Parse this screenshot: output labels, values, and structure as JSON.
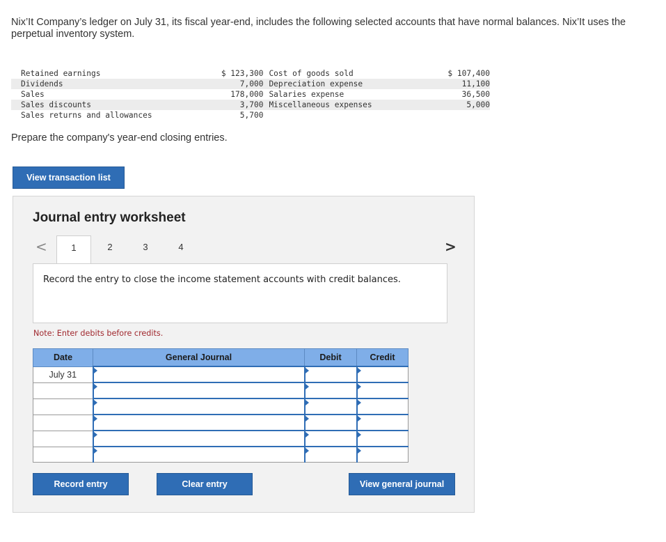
{
  "intro": "Nix’It Company’s ledger on July 31, its fiscal year-end, includes the following selected accounts that have normal balances. Nix’It uses the perpetual inventory system.",
  "ledger": [
    {
      "acct1": "Retained earnings",
      "amt1": "$ 123,300",
      "acct2": "Cost of goods sold",
      "amt2": "$ 107,400"
    },
    {
      "acct1": "Dividends",
      "amt1": "7,000",
      "acct2": "Depreciation expense",
      "amt2": "11,100"
    },
    {
      "acct1": "Sales",
      "amt1": "178,000",
      "acct2": "Salaries expense",
      "amt2": "36,500"
    },
    {
      "acct1": "Sales discounts",
      "amt1": "3,700",
      "acct2": "Miscellaneous expenses",
      "amt2": "5,000"
    },
    {
      "acct1": "Sales returns and allowances",
      "amt1": "5,700",
      "acct2": "",
      "amt2": ""
    }
  ],
  "prompt": "Prepare the company's year-end closing entries.",
  "buttons": {
    "view_transaction_list": "View transaction list",
    "record_entry": "Record entry",
    "clear_entry": "Clear entry",
    "view_general_journal": "View general journal"
  },
  "worksheet": {
    "title": "Journal entry worksheet",
    "tabs": [
      "1",
      "2",
      "3",
      "4"
    ],
    "active_tab": "1",
    "prev_arrow": "<",
    "next_arrow": ">",
    "instruction": "Record the entry to close the income statement accounts with credit balances.",
    "note": "Note: Enter debits before credits."
  },
  "journal": {
    "headers": {
      "date": "Date",
      "general_journal": "General Journal",
      "debit": "Debit",
      "credit": "Credit"
    },
    "rows": [
      {
        "date": "July 31"
      },
      {
        "date": ""
      },
      {
        "date": ""
      },
      {
        "date": ""
      },
      {
        "date": ""
      },
      {
        "date": ""
      }
    ]
  },
  "colors": {
    "button_blue": "#2f6db5",
    "header_blue": "#7faee8",
    "note_red": "#a0282e"
  }
}
